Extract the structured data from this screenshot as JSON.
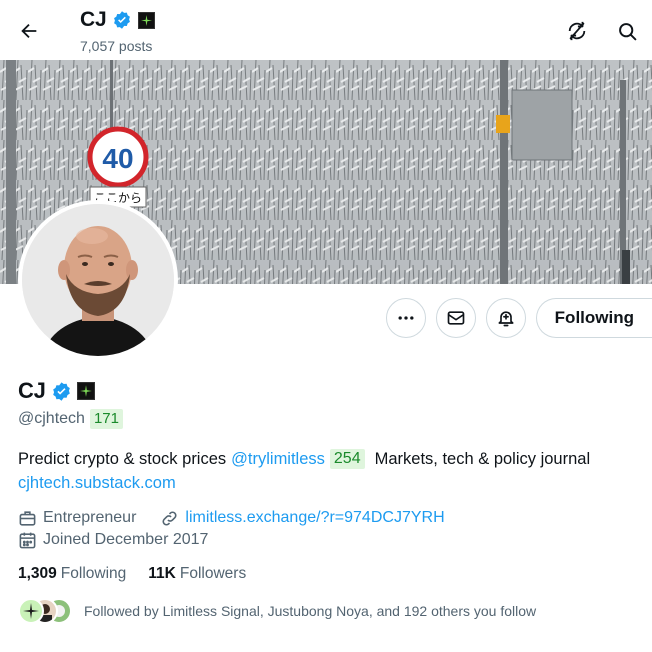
{
  "header": {
    "name": "CJ",
    "posts_count": "7,057 posts"
  },
  "icons": {
    "back": "back-arrow-icon",
    "verified": "verified-badge-icon",
    "affiliate": "affiliate-badge-icon",
    "refresh": "refresh-icon",
    "search": "search-icon",
    "more": "more-icon",
    "message": "message-icon",
    "notify": "notification-bell-icon",
    "briefcase": "briefcase-icon",
    "link": "link-icon",
    "calendar": "calendar-icon"
  },
  "colors": {
    "accent": "#1d9bf0",
    "verified": "#1d9bf0",
    "text_primary": "#0f1419",
    "text_secondary": "#536471",
    "pill_bg": "#dff5dd",
    "pill_text": "#1a8a2b"
  },
  "banner": {
    "sign_number": "40",
    "sign_text": "ここから"
  },
  "actions": {
    "follow_label": "Following"
  },
  "profile": {
    "name": "CJ",
    "handle": "@cjhtech",
    "handle_count": "171",
    "bio_part1": "Predict crypto & stock prices",
    "bio_mention": "@trylimitless",
    "bio_count": "254",
    "bio_part2": "Markets, tech & policy journal",
    "bio_link": "cjhtech.substack.com",
    "profession": "Entrepreneur",
    "website": "limitless.exchange/?r=974DCJ7YRH",
    "joined": "Joined December 2017"
  },
  "stats": {
    "following_count": "1,309",
    "following_label": "Following",
    "followers_count": "11K",
    "followers_label": "Followers"
  },
  "followed_by": {
    "text": "Followed by Limitless Signal, Justubong Noya, and 192 others you follow"
  }
}
